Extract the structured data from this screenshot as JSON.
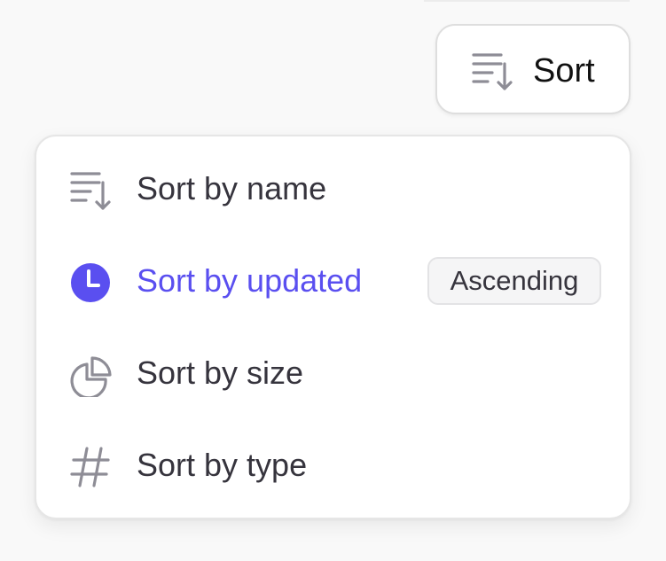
{
  "sort_button": {
    "label": "Sort",
    "icon": "sort-lines-down-icon"
  },
  "menu": {
    "items": [
      {
        "label": "Sort by name",
        "icon": "sort-lines-down-icon",
        "active": false
      },
      {
        "label": "Sort by updated",
        "icon": "clock-icon",
        "active": true,
        "badge": "Ascending"
      },
      {
        "label": "Sort by size",
        "icon": "pie-chart-icon",
        "active": false
      },
      {
        "label": "Sort by type",
        "icon": "hash-icon",
        "active": false
      }
    ]
  },
  "colors": {
    "accent": "#5a4ff0",
    "text": "#36343d",
    "icon_gray": "#8e8d96",
    "background": "#f9f9f9",
    "surface": "#ffffff"
  }
}
